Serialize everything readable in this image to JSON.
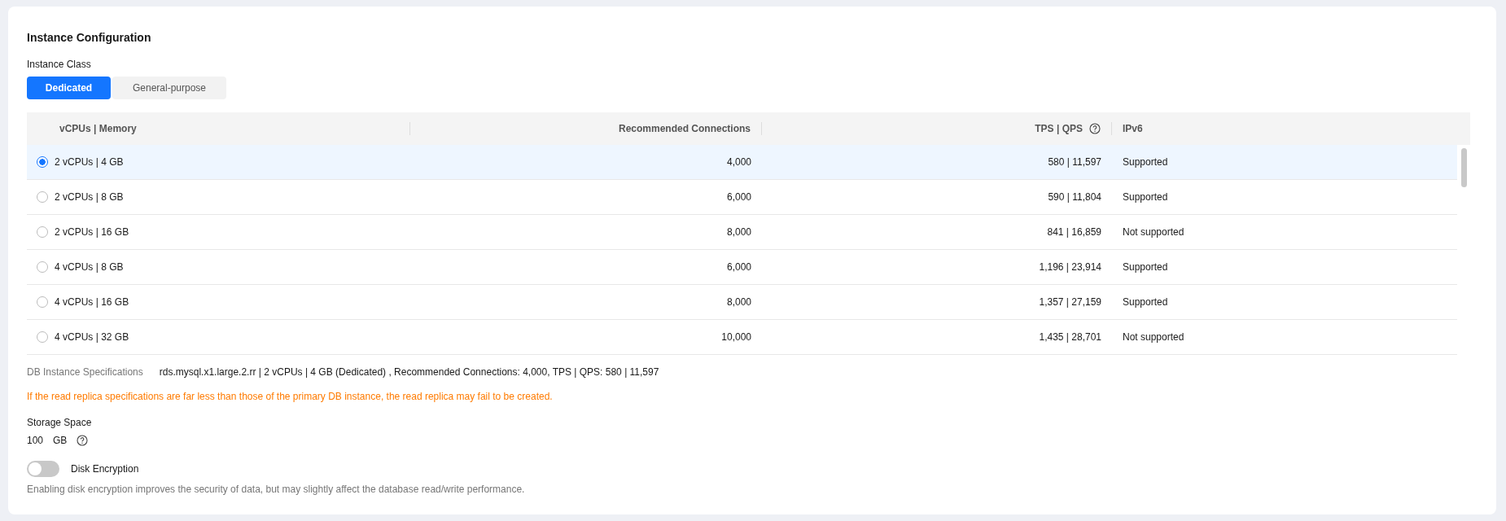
{
  "title": "Instance Configuration",
  "instance_class": {
    "label": "Instance Class",
    "options": [
      {
        "label": "Dedicated",
        "selected": true
      },
      {
        "label": "General-purpose",
        "selected": false
      }
    ]
  },
  "table": {
    "columns": [
      "vCPUs | Memory",
      "Recommended Connections",
      "TPS | QPS",
      "IPv6"
    ],
    "rows": [
      {
        "selected": true,
        "spec": "2 vCPUs | 4 GB",
        "connections": "4,000",
        "tps_qps": "580 | 11,597",
        "ipv6": "Supported"
      },
      {
        "selected": false,
        "spec": "2 vCPUs | 8 GB",
        "connections": "6,000",
        "tps_qps": "590 | 11,804",
        "ipv6": "Supported"
      },
      {
        "selected": false,
        "spec": "2 vCPUs | 16 GB",
        "connections": "8,000",
        "tps_qps": "841 | 16,859",
        "ipv6": "Not supported"
      },
      {
        "selected": false,
        "spec": "4 vCPUs | 8 GB",
        "connections": "6,000",
        "tps_qps": "1,196 | 23,914",
        "ipv6": "Supported"
      },
      {
        "selected": false,
        "spec": "4 vCPUs | 16 GB",
        "connections": "8,000",
        "tps_qps": "1,357 | 27,159",
        "ipv6": "Supported"
      },
      {
        "selected": false,
        "spec": "4 vCPUs | 32 GB",
        "connections": "10,000",
        "tps_qps": "1,435 | 28,701",
        "ipv6": "Not supported"
      }
    ]
  },
  "db_spec": {
    "label": "DB Instance Specifications",
    "value": "rds.mysql.x1.large.2.rr | 2 vCPUs | 4 GB (Dedicated) , Recommended Connections: 4,000, TPS | QPS: 580 | 11,597"
  },
  "warning": "If the read replica specifications are far less than those of the primary DB instance, the read replica may fail to be created.",
  "storage": {
    "label": "Storage Space",
    "value": "100",
    "unit": "GB"
  },
  "disk_encryption": {
    "label": "Disk Encryption",
    "on": false,
    "hint": "Enabling disk encryption improves the security of data, but may slightly affect the database read/write performance."
  }
}
